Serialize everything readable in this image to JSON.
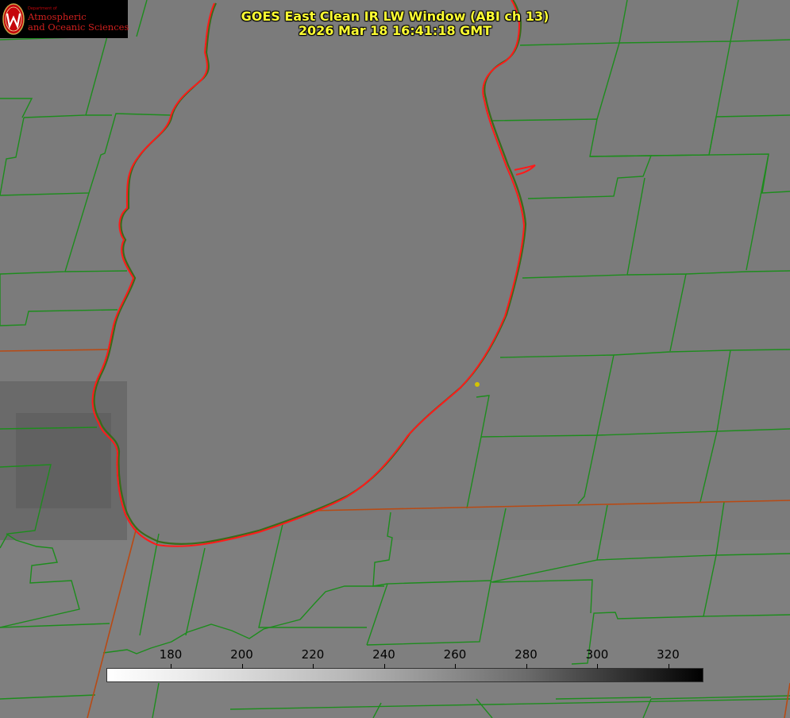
{
  "title": {
    "line1": "GOES East Clean IR LW Window (ABI ch 13)",
    "line2": "2026 Mar 18 16:41:18 GMT"
  },
  "logo": {
    "department": "Department of",
    "line1": "Atmospheric",
    "line2": "and Oceanic Sciences"
  },
  "colorbar": {
    "ticks": [
      "180",
      "200",
      "220",
      "240",
      "260",
      "280",
      "300",
      "320"
    ],
    "colors": {
      "low": "#ffffff",
      "high": "#000000"
    }
  },
  "map": {
    "colors": {
      "county_lines": "#1d8c1d",
      "state_lines": "#b84a14",
      "lake_outline": "#ff1a1a",
      "marker": "#d4c400"
    }
  }
}
